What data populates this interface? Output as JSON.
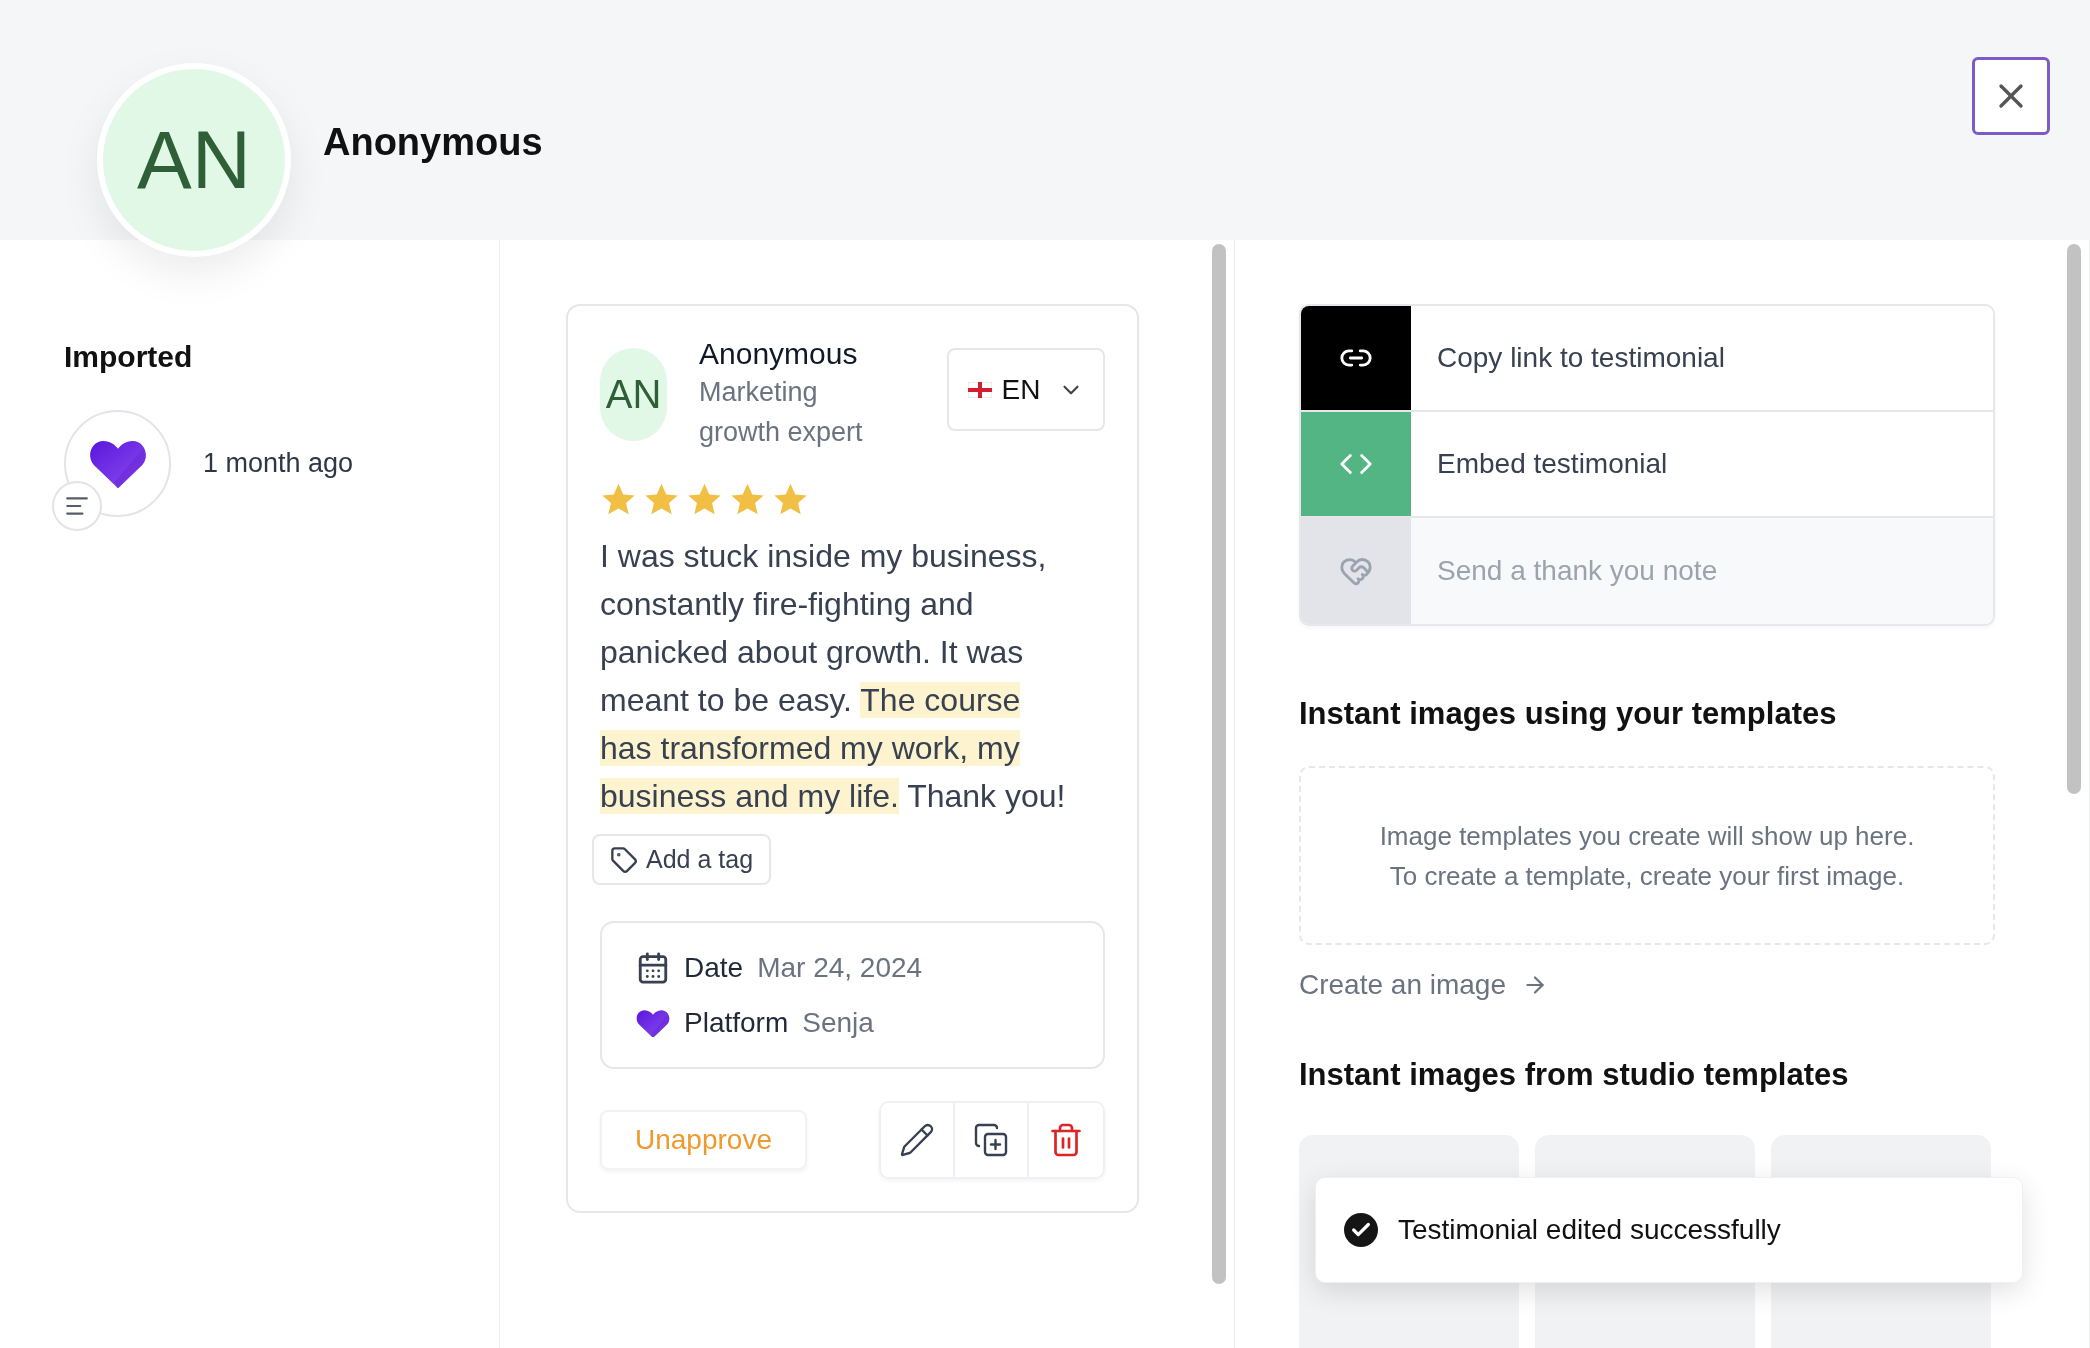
{
  "header": {
    "avatar_initials": "AN",
    "name": "Anonymous"
  },
  "source": {
    "title": "Imported",
    "time": "1 month ago"
  },
  "testimonial": {
    "avatar_initials": "AN",
    "name": "Anonymous",
    "role": "Marketing growth expert",
    "language": "EN",
    "stars": 5,
    "text_segments": [
      {
        "text": "I was stuck inside my business, constantly fire-fighting and panicked about growth. It was meant to be easy. ",
        "highlighted": false
      },
      {
        "text": "The course has transformed my work, my business and my life.",
        "highlighted": true
      },
      {
        "text": " Thank you!",
        "highlighted": false
      }
    ],
    "tag_button": "Add a tag",
    "details": [
      {
        "kind": "date",
        "label": "Date",
        "value": "Mar 24, 2024"
      },
      {
        "kind": "platform",
        "label": "Platform",
        "value": "Senja"
      }
    ],
    "unapprove_button": "Unapprove"
  },
  "actions": [
    {
      "kind": "link",
      "label": "Copy link to testimonial",
      "disabled": false
    },
    {
      "kind": "embed",
      "label": "Embed testimonial",
      "disabled": false
    },
    {
      "kind": "thanks",
      "label": "Send a thank you note",
      "disabled": true
    }
  ],
  "templates": {
    "title": "Instant images using your templates",
    "empty_message": [
      "Image templates you create will show up here.",
      "To create a template, create your first image."
    ],
    "create_link": "Create an image"
  },
  "studio": {
    "title": "Instant images from studio templates"
  },
  "toast": {
    "message": "Testimonial edited successfully"
  }
}
